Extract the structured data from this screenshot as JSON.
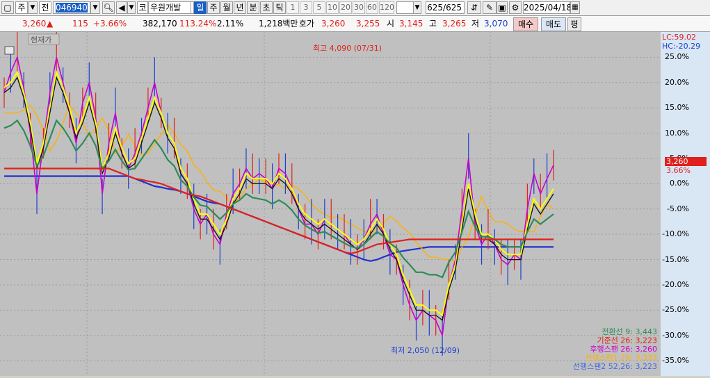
{
  "toolbar": {
    "market": "주",
    "prev": "전",
    "code": "046940",
    "market_tag": "코",
    "name": "우원개발",
    "period_tabs": [
      "일",
      "주",
      "월",
      "년",
      "분",
      "초",
      "틱"
    ],
    "selected_tab": "일",
    "intervals": [
      "1",
      "3",
      "5",
      "10",
      "20",
      "30",
      "60",
      "120"
    ],
    "count": "625/625",
    "date": "2025/04/18"
  },
  "quote": {
    "price": "3,260",
    "change": "115",
    "pct": "+3.66%",
    "volume": "382,170",
    "vol_ratio": "113.24%",
    "turnover": "2.11%",
    "amount": "1,218백만",
    "ask_label": "호가",
    "ask1": "3,260",
    "ask2": "3,255",
    "open_label": "시",
    "open": "3,145",
    "high_label": "고",
    "high": "3,265",
    "low_label": "저",
    "low": "3,070",
    "buy": "매수",
    "sell": "매도",
    "eval": "평"
  },
  "colors": {
    "up": "#e0201b",
    "down": "#1a3fd0",
    "background": "#c0c0c0"
  },
  "chart_data": {
    "type": "line",
    "indicator": "Ichimoku",
    "label_current": "현재가",
    "max_annotation": "최고 4,090 (07/31)",
    "min_annotation": "최저 2,050 (12/09)",
    "lc_label": "LC:59.02",
    "hc_label": "HC:-20.29",
    "y_axis": {
      "unit": "%",
      "ticks": [
        "25.0%",
        "20.0%",
        "15.0%",
        "10.0%",
        "5.0%",
        "0.0%",
        "-5.0%",
        "-10.0%",
        "-15.0%",
        "-20.0%",
        "-25.0%",
        "-30.0%",
        "-35.0%"
      ],
      "range": [
        -38,
        30
      ]
    },
    "current_price_tag": "3,260",
    "current_pct_tag": "3.66%",
    "legend": [
      {
        "label": "전환선 9: 3,443",
        "color": "#2e8b57"
      },
      {
        "label": "기준선 26: 3,223",
        "color": "#e0201b"
      },
      {
        "label": "후행스팬 26: 3,260",
        "color": "#cc00cc"
      },
      {
        "label": "선행스팬1 26: 3,333",
        "color": "#ffb000"
      },
      {
        "label": "선행스팬2 52,26: 3,223",
        "color": "#4169e1"
      }
    ],
    "series": {
      "price_pct": [
        18,
        22,
        25,
        19,
        10,
        -2,
        8,
        18,
        25,
        20,
        14,
        8,
        16,
        20,
        13,
        -2,
        8,
        14,
        6,
        3,
        6,
        10,
        15,
        20,
        14,
        10,
        8,
        2,
        0,
        -5,
        -8,
        -6,
        -10,
        -12,
        -6,
        -2,
        0,
        3,
        1,
        2,
        1,
        -1,
        3,
        2,
        -1,
        -5,
        -8,
        -8,
        -10,
        -7,
        -8,
        -9,
        -10,
        -12,
        -13,
        -11,
        -8,
        -6,
        -10,
        -14,
        -15,
        -20,
        -24,
        -27,
        -25,
        -26,
        -27,
        -30,
        -20,
        -15,
        -5,
        5,
        -8,
        -12,
        -10,
        -12,
        -15,
        -16,
        -14,
        -15,
        -5,
        2,
        -2,
        1,
        3.66
      ],
      "tenkan_pct": [
        19,
        20,
        22,
        18,
        12,
        4,
        8,
        15,
        22,
        19,
        15,
        10,
        13,
        17,
        12,
        3,
        6,
        11,
        7,
        4,
        5,
        9,
        13,
        17,
        14,
        10,
        8,
        3,
        1,
        -3,
        -6,
        -6,
        -8,
        -10,
        -7,
        -3,
        -1,
        2,
        1,
        1,
        1,
        0,
        2,
        1,
        -1,
        -4,
        -6,
        -7,
        -8,
        -7,
        -8,
        -9,
        -10,
        -11,
        -12,
        -11,
        -9,
        -7,
        -9,
        -12,
        -14,
        -18,
        -21,
        -24,
        -24,
        -25,
        -25,
        -26,
        -20,
        -16,
        -8,
        0,
        -6,
        -10,
        -10,
        -11,
        -13,
        -14,
        -14,
        -14,
        -8,
        -3,
        -5,
        -3,
        -1
      ],
      "kijun_pct": [
        3,
        3,
        3,
        3,
        3,
        3,
        3,
        3,
        3,
        3,
        3,
        3,
        3,
        3,
        3,
        3,
        3,
        2.5,
        2,
        1.5,
        1,
        0.8,
        0.5,
        0.3,
        0,
        -0.5,
        -1,
        -1.5,
        -2,
        -2.3,
        -2.5,
        -3,
        -3.5,
        -4,
        -4.5,
        -5,
        -5.5,
        -6,
        -6.5,
        -7,
        -7.5,
        -8,
        -8.5,
        -9,
        -9.5,
        -10,
        -10.5,
        -11,
        -11.5,
        -12,
        -12.5,
        -13,
        -13.5,
        -13.8,
        -13.5,
        -13,
        -12.5,
        -12,
        -11.8,
        -11.6,
        -11.4,
        -11.2,
        -11,
        -11,
        -11,
        -11,
        -11,
        -11,
        -11,
        -11,
        -11,
        -11,
        -11,
        -11,
        -11,
        -11,
        -11,
        -11,
        -11,
        -11,
        -11,
        -11,
        -11,
        -11,
        -11
      ]
    }
  }
}
